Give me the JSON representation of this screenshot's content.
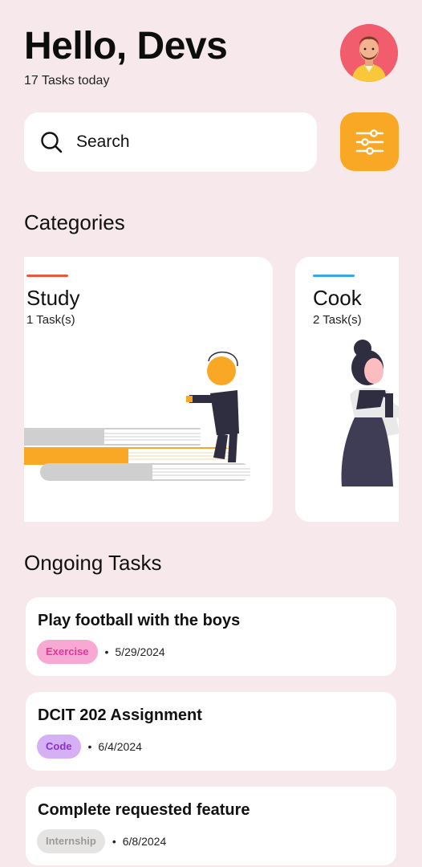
{
  "header": {
    "greeting": "Hello, Devs",
    "subtitle": "17 Tasks today"
  },
  "search": {
    "label": "Search",
    "icon": "search-icon",
    "filter_icon": "sliders-icon"
  },
  "categories": {
    "title": "Categories",
    "items": [
      {
        "name": "Study",
        "count": "1 Task(s)",
        "accent": "#e9573f"
      },
      {
        "name": "Cook",
        "count": "2 Task(s)",
        "accent": "#3ba6ea"
      }
    ]
  },
  "tasks": {
    "title": "Ongoing Tasks",
    "items": [
      {
        "title": "Play football with the boys",
        "tag": "Exercise",
        "date": "5/29/2024",
        "tag_bg": "#f7a8d3",
        "tag_color": "#e0389a"
      },
      {
        "title": "DCIT 202 Assignment",
        "tag": "Code",
        "date": "6/4/2024",
        "tag_bg": "#d6b0f5",
        "tag_color": "#8a2fd0"
      },
      {
        "title": "Complete requested feature",
        "tag": "Internship",
        "date": "6/8/2024",
        "tag_bg": "#e6e3e3",
        "tag_color": "#9a9a9a"
      }
    ]
  },
  "colors": {
    "background": "#f7e9eb",
    "accent": "#f9a826"
  }
}
